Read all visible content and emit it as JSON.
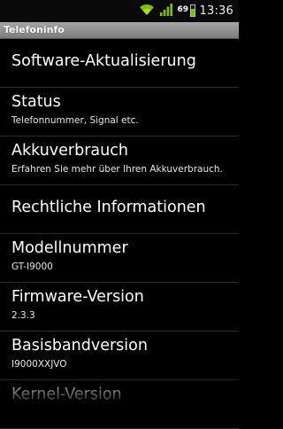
{
  "status_bar": {
    "time": "13:36",
    "battery_level": "69",
    "battery_fraction": 0.69,
    "icons": [
      "wifi-icon",
      "signal-icon",
      "battery-icon"
    ],
    "accent": "#7ec000"
  },
  "header": {
    "title": "Telefoninfo"
  },
  "items": [
    {
      "title": "Software-Aktualisierung",
      "subtitle": ""
    },
    {
      "title": "Status",
      "subtitle": "Telefonnummer, Signal etc."
    },
    {
      "title": "Akkuverbrauch",
      "subtitle": "Erfahren Sie mehr über Ihren Akkuverbrauch."
    },
    {
      "title": "Rechtliche Informationen",
      "subtitle": ""
    },
    {
      "title": "Modellnummer",
      "subtitle": "GT-I9000"
    },
    {
      "title": "Firmware-Version",
      "subtitle": "2.3.3"
    },
    {
      "title": "Basisbandversion",
      "subtitle": "I9000XXJVO"
    },
    {
      "title": "Kernel-Version",
      "subtitle": ""
    }
  ]
}
